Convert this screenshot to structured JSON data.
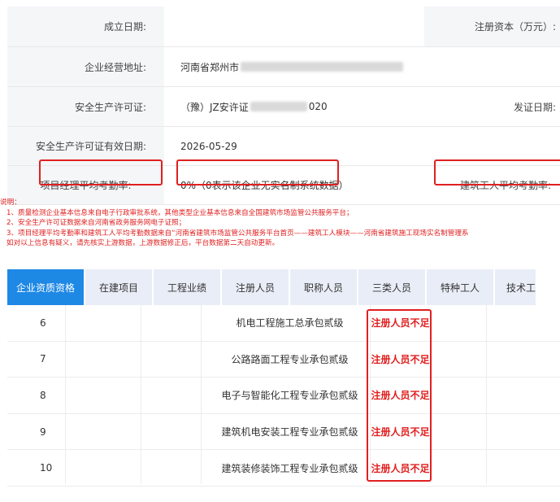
{
  "company_info": {
    "rows": [
      {
        "label": "成立日期:",
        "value": "",
        "label2": "注册资本（万元）:",
        "value2": ""
      },
      {
        "label": "企业经营地址:",
        "value": "河南省郑州市"
      },
      {
        "label": "安全生产许可证:",
        "value": "（豫）JZ安许证",
        "value_tail": "020",
        "label2": "发证日期:"
      },
      {
        "label": "安全生产许可证有效日期:",
        "value": "2026-05-29"
      },
      {
        "label": "项目经理平均考勤率:",
        "value": "0%（0表示该企业无实名制系统数据）",
        "label2": "建筑工人平均考勤率:"
      }
    ]
  },
  "notes": [
    "说明：",
    "1、质量检测企业基本信息来自电子行政审批系统，其他类型企业基本信息来自全国建筑市场监管公共服务平台；",
    "2、安全生产许可证数据来自河南省政务服务网电子证照；",
    "3、项目经理平均考勤率和建筑工人平均考勤数据来自“河南省建筑市场监管公共服务平台首页——建筑工人模块——河南省建筑施工现场实名制管理系",
    "如对以上信息有疑义，请先核实上游数据，上游数据修正后，平台数据第二天自动更新。"
  ],
  "tabs": [
    {
      "label": "企业资质资格",
      "active": true
    },
    {
      "label": "在建项目"
    },
    {
      "label": "工程业绩"
    },
    {
      "label": "注册人员"
    },
    {
      "label": "职称人员"
    },
    {
      "label": "三类人员"
    },
    {
      "label": "特种工人"
    },
    {
      "label": "技术工"
    }
  ],
  "qualifications": [
    {
      "num": "6",
      "name": "机电工程施工总承包贰级",
      "status": "注册人员不足"
    },
    {
      "num": "7",
      "name": "公路路面工程专业承包贰级",
      "status": "注册人员不足"
    },
    {
      "num": "8",
      "name": "电子与智能化工程专业承包贰级",
      "status": "注册人员不足"
    },
    {
      "num": "9",
      "name": "建筑机电安装工程专业承包贰级",
      "status": "注册人员不足"
    },
    {
      "num": "10",
      "name": "建筑装修装饰工程专业承包贰级",
      "status": "注册人员不足"
    }
  ],
  "colors": {
    "accent": "#1e88e5",
    "alert": "#e02020",
    "label_bg": "#f5f6f8",
    "tab_bg": "#e9edf7"
  }
}
